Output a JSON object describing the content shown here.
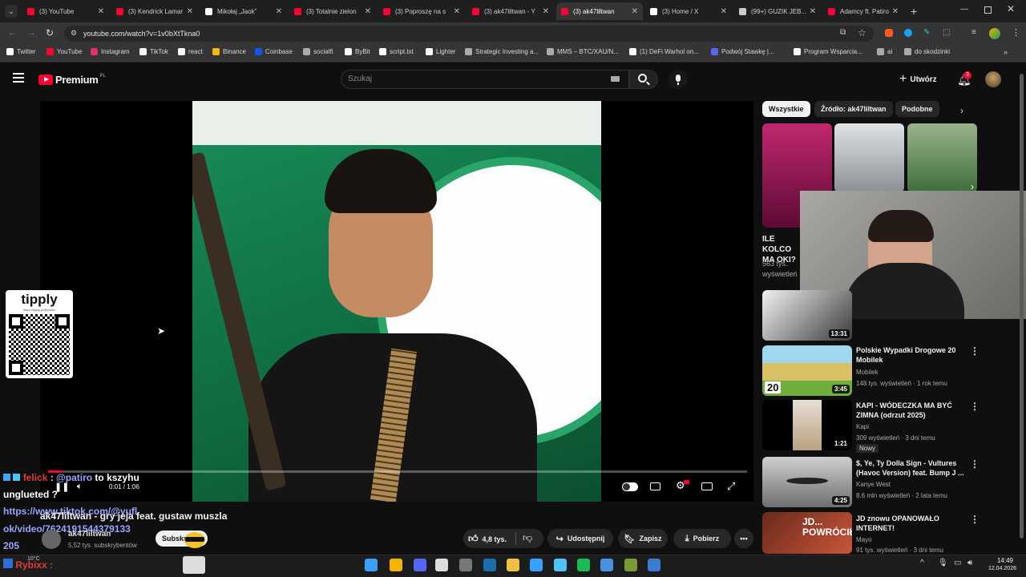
{
  "tabs": [
    {
      "label": "(3) YouTube",
      "color": "#ff0033"
    },
    {
      "label": "(3) Kendrick Lamar",
      "color": "#ff0033"
    },
    {
      "label": "Mikołaj „Jaok”",
      "color": "#ffffff"
    },
    {
      "label": "(3) Totalnie zielon",
      "color": "#ff0033"
    },
    {
      "label": "(3) Poproszę na s",
      "color": "#ff0033"
    },
    {
      "label": "(3) ak47liltwan - Y",
      "color": "#ff0033"
    },
    {
      "label": "(3) ak47liltwan",
      "color": "#ff0033"
    },
    {
      "label": "(3) Home / X",
      "color": "#ffffff"
    },
    {
      "label": "(99+) GUZIK JEB...",
      "color": "#cccccc"
    },
    {
      "label": "Adamcy ft. Patiro",
      "color": "#ff0033"
    }
  ],
  "address": {
    "url": "youtube.com/watch?v=1v0bXtTkna0"
  },
  "bookmarks": [
    {
      "label": "Twitter",
      "color": "#ffffff"
    },
    {
      "label": "YouTube",
      "color": "#ff0033"
    },
    {
      "label": "Instagram",
      "color": "#e1306c"
    },
    {
      "label": "TikTok",
      "color": "#ffffff"
    },
    {
      "label": "react",
      "color": "#ffffff"
    },
    {
      "label": "Binance",
      "color": "#f0b90b"
    },
    {
      "label": "Coinbase",
      "color": "#1652f0"
    },
    {
      "label": "socialfi",
      "color": "#aaaaaa"
    },
    {
      "label": "ByBit",
      "color": "#ffffff"
    },
    {
      "label": "script.txt",
      "color": "#ffffff"
    },
    {
      "label": "Lighter",
      "color": "#ffffff"
    },
    {
      "label": "Strategic Investing a...",
      "color": "#aaaaaa"
    },
    {
      "label": "MMS – BTC/XAU/N...",
      "color": "#aaaaaa"
    },
    {
      "label": "(1) DeFi Warhol on...",
      "color": "#ffffff"
    },
    {
      "label": "Podwój Stawkę |...",
      "color": "#5865f2"
    },
    {
      "label": "Program Wsparcia...",
      "color": "#ffffff"
    },
    {
      "label": "ai",
      "color": "#aaaaaa"
    },
    {
      "label": "do skodzinki",
      "color": "#aaaaaa"
    }
  ],
  "header": {
    "logo_text": "Premium",
    "region": "PL",
    "search_placeholder": "Szukaj",
    "create_label": "Utwórz",
    "notifications_count": "3"
  },
  "chips": [
    "Wszystkie",
    "Źródło: ak47liltwan",
    "Podobne"
  ],
  "video": {
    "time": "0:01 / 1:06",
    "title_overlay": "ak47liltwan - gry jeja feat. gustaw muszla",
    "channel": "ak47liltwan",
    "subscribers": "5,52 tys. subskrybentów",
    "subscribe_label": "Subskrybuj",
    "progress_fraction": 0.02
  },
  "actions": {
    "likes": "4,8 tys.",
    "share": "Udostępnij",
    "save": "Zapisz",
    "download": "Pobierz"
  },
  "overlay": {
    "tipply_label": "tipply",
    "tipply_url": "https://tipply.pl/@patiro",
    "chat_user": "felick",
    "chat_mention": "@patiro",
    "chat_text": " to kszyhu",
    "chat_line2": "unglueted ?",
    "chat_link1": "https://www.tiktok.com/@yufl",
    "chat_link2": "ok/video/7624191544379133",
    "chat_link3": "205",
    "bottom_user": "Rybixx",
    "weather": "10°C"
  },
  "recommendations": {
    "top_title_partial": "ILE KOLCO MA OKI?",
    "top_views_partial": "563 tys. wyświetleń",
    "items": [
      {
        "title": "",
        "channel": "",
        "meta": "",
        "duration": "13:31"
      },
      {
        "title": "Polskie Wypadki Drogowe 20 Mobilek",
        "channel": "Mobilek",
        "meta": "148 tys. wyświetleń · 1 rok temu",
        "duration": "3:45",
        "badge": "20"
      },
      {
        "title": "KAPI - WÓDECZKA MA BYĆ ZIMNA (odrzut 2025)",
        "channel": "Kapi",
        "meta": "309 wyświetleń · 3 dni temu",
        "duration": "1:21",
        "tag": "Nowy"
      },
      {
        "title": "$, Ye, Ty Dolla Sign - Vultures (Havoc Version) feat. Bump J ...",
        "channel": "Kanye West",
        "meta": "8,6 mln wyświetleń · 2 lata temu",
        "duration": "4:25"
      },
      {
        "title": "JD znowu OPANOWAŁO INTERNET!",
        "channel": "Mayo",
        "meta": "91 tys. wyświetleń · 3 dni temu",
        "duration": "",
        "thumb_text": "JD... POWRÓCIŁO"
      }
    ]
  },
  "taskbar": {
    "time": "14:49",
    "date": "12.04.2026"
  },
  "colors": {
    "accent": "#ff0033",
    "bg": "#0f0f0f",
    "link": "#3ea6ff",
    "chat_link": "#9ba3ff"
  }
}
